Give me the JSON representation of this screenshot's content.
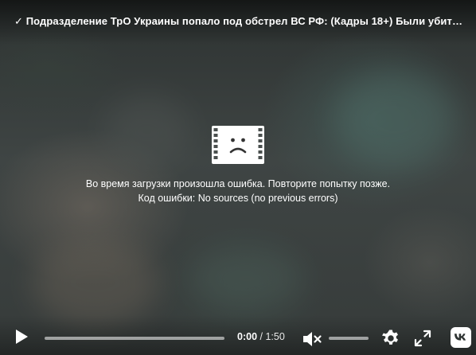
{
  "video": {
    "title": "✓ Подразделение ТрО Украины попало под обстрел ВС РФ: (Кадры 18+) Были убиты неск..."
  },
  "error": {
    "message": "Во время загрузки произошла ошибка. Повторите попытку позже.",
    "code_line": "Код ошибки: No sources (no previous errors)",
    "icon": "sad-film-icon"
  },
  "controls": {
    "current_time": "0:00",
    "separator": " / ",
    "duration": "1:50",
    "progress": 0,
    "volume": 0,
    "muted": true,
    "icons": {
      "play": "play-icon",
      "mute": "volume-muted-icon",
      "settings": "gear-icon",
      "fullscreen": "fullscreen-icon",
      "logo": "vk-logo-icon"
    }
  },
  "colors": {
    "text": "#ffffff",
    "track": "#bfbfbf"
  }
}
